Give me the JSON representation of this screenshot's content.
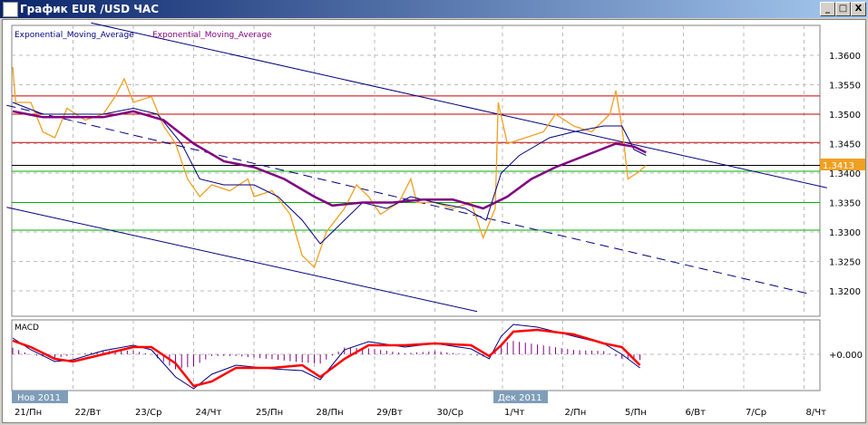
{
  "window": {
    "title": "График EUR /USD  ЧАС",
    "min": "_",
    "max": "□",
    "close": "X"
  },
  "legend": {
    "ema1": "Exponential_Moving_Average",
    "ema2": "Exponential_Moving_Average"
  },
  "macd_label": "MACD",
  "macd_zero_label": "+0.000",
  "months": [
    "Нов 2011",
    "Дек 2011"
  ],
  "chart_data": {
    "type": "line",
    "title": "График EUR /USD  ЧАС",
    "x_ticks": [
      "21/Пн",
      "22/Вт",
      "23/Ср",
      "24/Чт",
      "25/Пн",
      "28/Пн",
      "29/Вт",
      "30/Ср",
      "1/Чт",
      "2/Пн",
      "5/Пн",
      "6/Вт",
      "7/Ср",
      "8/Чт"
    ],
    "y_ticks": [
      "1.3600",
      "1.3550",
      "1.3500",
      "1.3450",
      "1.3400",
      "1.3350",
      "1.3300",
      "1.3250",
      "1.3200"
    ],
    "ylim": [
      1.316,
      1.365
    ],
    "last_price": "1.3413",
    "colors": {
      "price": "#f0a020",
      "ema_fast": "#000080",
      "ema_slow": "#800080",
      "resistance": "#cc0000",
      "support": "#00b000",
      "current": "#000000",
      "channel": "#000080",
      "macd": "#000080",
      "signal": "#ff0000",
      "hist": "#800080"
    },
    "horizontal_levels": {
      "resistance": [
        1.3531,
        1.35,
        1.3452
      ],
      "current": 1.3413,
      "support": [
        1.3403,
        1.335,
        1.3303
      ]
    },
    "channel": {
      "upper": [
        [
          1.3,
          1.3655
        ],
        [
          13.5,
          1.3375
        ]
      ],
      "middle": [
        [
          -0.1,
          1.3515
        ],
        [
          13.2,
          1.3195
        ]
      ],
      "lower": [
        [
          -0.1,
          1.3342
        ],
        [
          7.7,
          1.3165
        ]
      ]
    },
    "price": [
      [
        0,
        1.358
      ],
      [
        0.05,
        1.352
      ],
      [
        0.3,
        1.352
      ],
      [
        0.5,
        1.347
      ],
      [
        0.7,
        1.346
      ],
      [
        0.9,
        1.351
      ],
      [
        1.2,
        1.349
      ],
      [
        1.5,
        1.35
      ],
      [
        1.7,
        1.353
      ],
      [
        1.85,
        1.356
      ],
      [
        2.0,
        1.352
      ],
      [
        2.3,
        1.353
      ],
      [
        2.5,
        1.348
      ],
      [
        2.7,
        1.345
      ],
      [
        2.9,
        1.339
      ],
      [
        3.1,
        1.336
      ],
      [
        3.3,
        1.338
      ],
      [
        3.6,
        1.337
      ],
      [
        3.9,
        1.339
      ],
      [
        4.0,
        1.336
      ],
      [
        4.3,
        1.337
      ],
      [
        4.6,
        1.333
      ],
      [
        4.8,
        1.326
      ],
      [
        5.0,
        1.324
      ],
      [
        5.2,
        1.33
      ],
      [
        5.5,
        1.334
      ],
      [
        5.7,
        1.338
      ],
      [
        5.9,
        1.336
      ],
      [
        6.1,
        1.333
      ],
      [
        6.4,
        1.335
      ],
      [
        6.6,
        1.339
      ],
      [
        6.7,
        1.335
      ],
      [
        7.0,
        1.335
      ],
      [
        7.3,
        1.334
      ],
      [
        7.6,
        1.335
      ],
      [
        7.8,
        1.329
      ],
      [
        8.0,
        1.334
      ],
      [
        8.05,
        1.352
      ],
      [
        8.2,
        1.345
      ],
      [
        8.5,
        1.346
      ],
      [
        8.8,
        1.347
      ],
      [
        9.0,
        1.35
      ],
      [
        9.3,
        1.348
      ],
      [
        9.6,
        1.347
      ],
      [
        9.9,
        1.35
      ],
      [
        10.0,
        1.354
      ],
      [
        10.1,
        1.348
      ],
      [
        10.2,
        1.339
      ],
      [
        10.35,
        1.34
      ],
      [
        10.5,
        1.3413
      ]
    ],
    "ema_fast": [
      [
        0,
        1.352
      ],
      [
        0.5,
        1.35
      ],
      [
        1.0,
        1.35
      ],
      [
        1.5,
        1.35
      ],
      [
        2.0,
        1.351
      ],
      [
        2.4,
        1.35
      ],
      [
        2.8,
        1.345
      ],
      [
        3.1,
        1.339
      ],
      [
        3.5,
        1.338
      ],
      [
        4.0,
        1.338
      ],
      [
        4.4,
        1.336
      ],
      [
        4.8,
        1.332
      ],
      [
        5.1,
        1.328
      ],
      [
        5.5,
        1.332
      ],
      [
        5.8,
        1.335
      ],
      [
        6.2,
        1.334
      ],
      [
        6.6,
        1.336
      ],
      [
        7.0,
        1.335
      ],
      [
        7.5,
        1.334
      ],
      [
        7.85,
        1.332
      ],
      [
        8.1,
        1.34
      ],
      [
        8.4,
        1.343
      ],
      [
        8.9,
        1.346
      ],
      [
        9.3,
        1.347
      ],
      [
        9.8,
        1.348
      ],
      [
        10.1,
        1.348
      ],
      [
        10.3,
        1.344
      ],
      [
        10.5,
        1.343
      ]
    ],
    "ema_slow": [
      [
        0,
        1.3505
      ],
      [
        0.5,
        1.3495
      ],
      [
        1.0,
        1.3495
      ],
      [
        1.5,
        1.3495
      ],
      [
        2.0,
        1.3505
      ],
      [
        2.5,
        1.349
      ],
      [
        3.0,
        1.345
      ],
      [
        3.5,
        1.342
      ],
      [
        4.0,
        1.341
      ],
      [
        4.5,
        1.339
      ],
      [
        5.0,
        1.336
      ],
      [
        5.3,
        1.3345
      ],
      [
        5.8,
        1.335
      ],
      [
        6.3,
        1.335
      ],
      [
        6.8,
        1.3355
      ],
      [
        7.3,
        1.3355
      ],
      [
        7.8,
        1.334
      ],
      [
        8.2,
        1.336
      ],
      [
        8.6,
        1.339
      ],
      [
        9.0,
        1.341
      ],
      [
        9.5,
        1.343
      ],
      [
        10.0,
        1.345
      ],
      [
        10.3,
        1.3445
      ],
      [
        10.5,
        1.3435
      ]
    ],
    "macd_ylim": [
      -0.004,
      0.004
    ],
    "signal": [
      [
        0,
        0.0015
      ],
      [
        0.3,
        0.0008
      ],
      [
        0.7,
        -0.0005
      ],
      [
        1.0,
        -0.0008
      ],
      [
        1.5,
        0.0
      ],
      [
        2.0,
        0.0008
      ],
      [
        2.3,
        0.0008
      ],
      [
        2.7,
        -0.001
      ],
      [
        3.0,
        -0.0035
      ],
      [
        3.3,
        -0.003
      ],
      [
        3.7,
        -0.0015
      ],
      [
        4.3,
        -0.0015
      ],
      [
        4.8,
        -0.0012
      ],
      [
        5.1,
        -0.0025
      ],
      [
        5.5,
        -0.0005
      ],
      [
        5.9,
        0.001
      ],
      [
        6.5,
        0.001
      ],
      [
        7.0,
        0.0012
      ],
      [
        7.6,
        0.001
      ],
      [
        7.9,
        -0.0002
      ],
      [
        8.1,
        0.001
      ],
      [
        8.3,
        0.0025
      ],
      [
        8.7,
        0.0027
      ],
      [
        9.3,
        0.0022
      ],
      [
        9.8,
        0.0012
      ],
      [
        10.1,
        0.0008
      ],
      [
        10.4,
        -0.0012
      ]
    ],
    "macd": [
      [
        0,
        0.0018
      ],
      [
        0.3,
        0.0005
      ],
      [
        0.7,
        -0.0008
      ],
      [
        1.0,
        -0.0006
      ],
      [
        1.5,
        0.0004
      ],
      [
        2.0,
        0.001
      ],
      [
        2.3,
        0.0005
      ],
      [
        2.7,
        -0.0025
      ],
      [
        3.0,
        -0.0038
      ],
      [
        3.3,
        -0.0022
      ],
      [
        3.7,
        -0.0012
      ],
      [
        4.3,
        -0.0016
      ],
      [
        4.8,
        -0.0018
      ],
      [
        5.1,
        -0.0028
      ],
      [
        5.5,
        0.0005
      ],
      [
        5.9,
        0.0014
      ],
      [
        6.5,
        0.0008
      ],
      [
        7.0,
        0.0012
      ],
      [
        7.6,
        0.0006
      ],
      [
        7.9,
        -0.0005
      ],
      [
        8.1,
        0.002
      ],
      [
        8.3,
        0.0033
      ],
      [
        8.7,
        0.003
      ],
      [
        9.3,
        0.002
      ],
      [
        9.8,
        0.0012
      ],
      [
        10.1,
        0.0
      ],
      [
        10.4,
        -0.0015
      ]
    ]
  }
}
